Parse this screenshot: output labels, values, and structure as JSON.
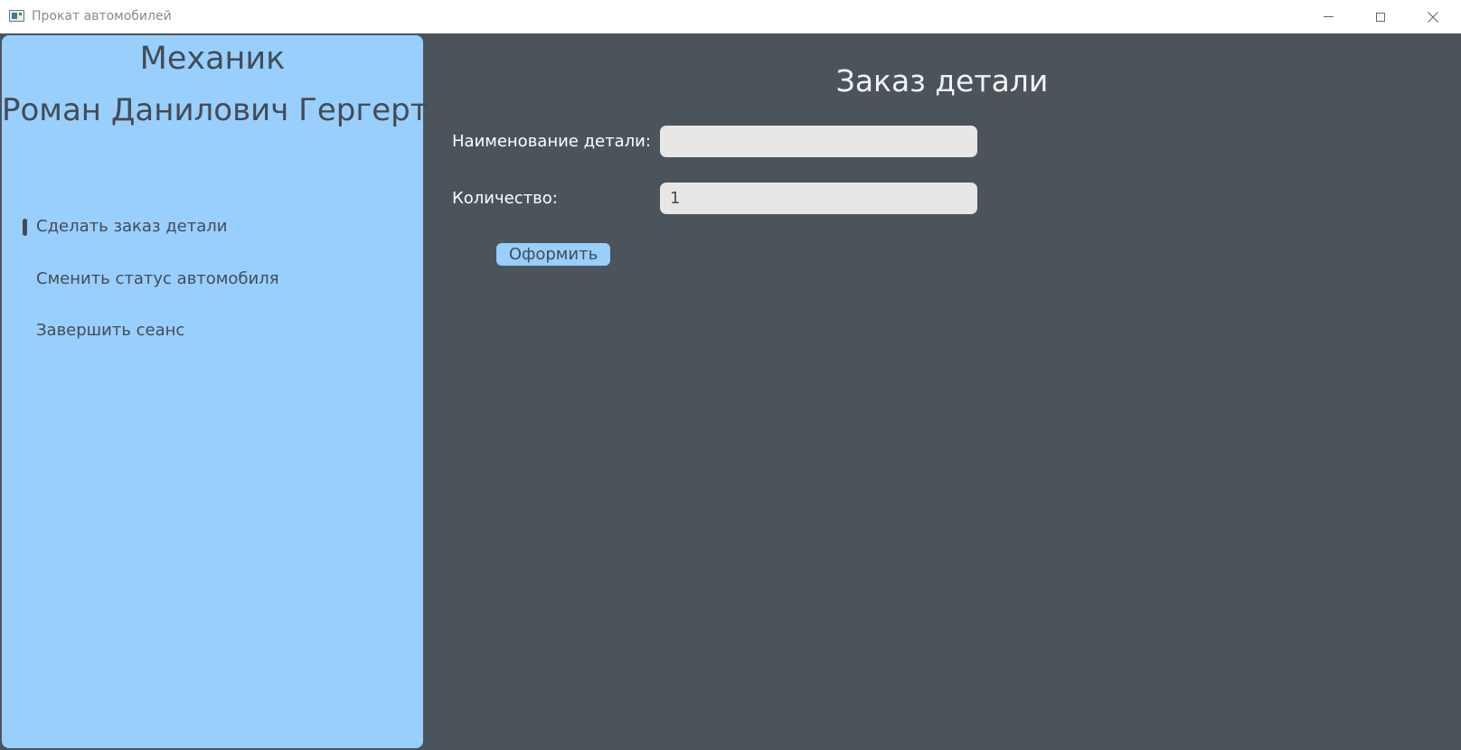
{
  "window": {
    "title": "Прокат автомобилей"
  },
  "sidebar": {
    "role": "Механик",
    "user_name": "Роман Данилович Гергерт",
    "items": [
      {
        "label": "Сделать заказ детали",
        "active": true
      },
      {
        "label": "Сменить статус автомобиля",
        "active": false
      },
      {
        "label": "Завершить сеанс",
        "active": false
      }
    ]
  },
  "main": {
    "title": "Заказ детали",
    "fields": {
      "part_name": {
        "label": "Наименование детали:",
        "value": ""
      },
      "quantity": {
        "label": "Количество:",
        "value": "1"
      }
    },
    "submit_label": "Оформить"
  },
  "colors": {
    "sidebar_bg": "#99cffd",
    "main_bg": "#4c545b",
    "input_bg": "#e9e6e6",
    "text_dark": "#434c55"
  }
}
